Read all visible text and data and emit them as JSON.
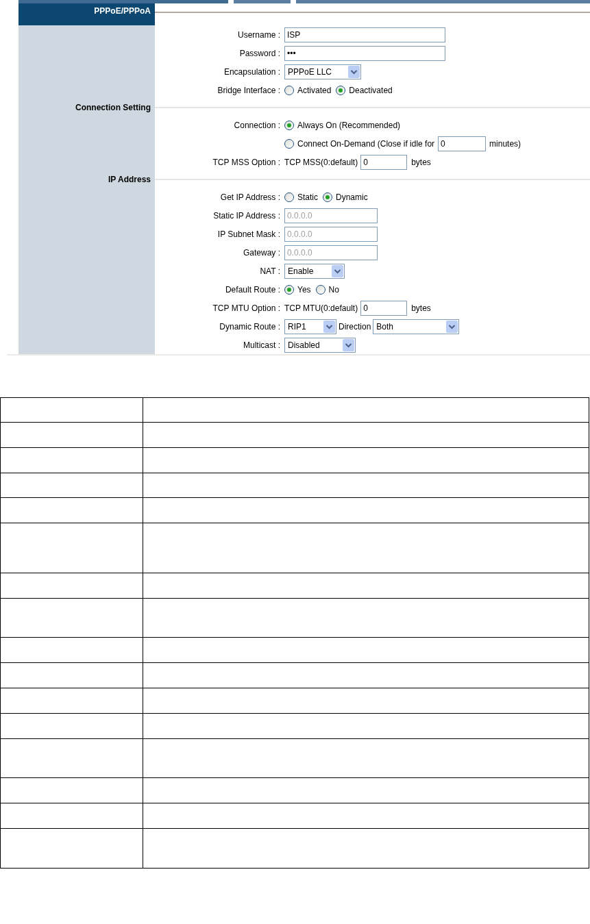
{
  "sections": [
    {
      "title": "PPPoE/PPPoA",
      "kind": "header",
      "fields": [
        {
          "label": "Username :",
          "kind": "text",
          "value": "ISP",
          "disabled": false
        },
        {
          "label": "Password :",
          "kind": "password",
          "value": "•••"
        },
        {
          "label": "Encapsulation :",
          "kind": "select",
          "value": "PPPoE LLC"
        },
        {
          "label": "Bridge Interface :",
          "kind": "radio",
          "options": [
            {
              "label": "Activated",
              "selected": false
            },
            {
              "label": "Deactivated",
              "selected": true
            }
          ]
        }
      ]
    },
    {
      "title": "Connection Setting",
      "kind": "section",
      "fields": [
        {
          "label": "Connection :",
          "kind": "radio_lines",
          "options": [
            {
              "label": "Always On (Recommended)",
              "selected": true
            },
            {
              "label": "Connect On-Demand (Close if idle for",
              "selected": false,
              "input": "0",
              "suffix": "minutes)"
            }
          ]
        },
        {
          "label": "TCP MSS Option :",
          "kind": "inline",
          "prefix": "TCP MSS(0:default)",
          "value": "0",
          "suffix": "bytes"
        }
      ]
    },
    {
      "title": "IP Address",
      "kind": "section",
      "fields": [
        {
          "label": "Get IP Address :",
          "kind": "radio",
          "options": [
            {
              "label": "Static",
              "selected": false
            },
            {
              "label": "Dynamic",
              "selected": true
            }
          ]
        },
        {
          "label": "Static IP Address :",
          "kind": "short_text",
          "value": "0.0.0.0",
          "disabled": true
        },
        {
          "label": "IP Subnet Mask :",
          "kind": "short_text",
          "value": "0.0.0.0",
          "disabled": true
        },
        {
          "label": "Gateway :",
          "kind": "short_text",
          "value": "0.0.0.0",
          "disabled": true
        },
        {
          "label": "NAT :",
          "kind": "select",
          "value": "Enable"
        },
        {
          "label": "Default Route :",
          "kind": "radio",
          "options": [
            {
              "label": "Yes",
              "selected": true
            },
            {
              "label": "No",
              "selected": false
            }
          ]
        },
        {
          "label": "TCP MTU Option :",
          "kind": "inline",
          "prefix": "TCP MTU(0:default)",
          "value": "0",
          "suffix": "bytes"
        },
        {
          "label": "Dynamic Route :",
          "kind": "selects",
          "items": [
            {
              "value": "RIP1"
            },
            {
              "prefix": "Direction",
              "value": "Both"
            }
          ]
        },
        {
          "label": "Multicast :",
          "kind": "select",
          "value": "Disabled"
        }
      ]
    }
  ]
}
